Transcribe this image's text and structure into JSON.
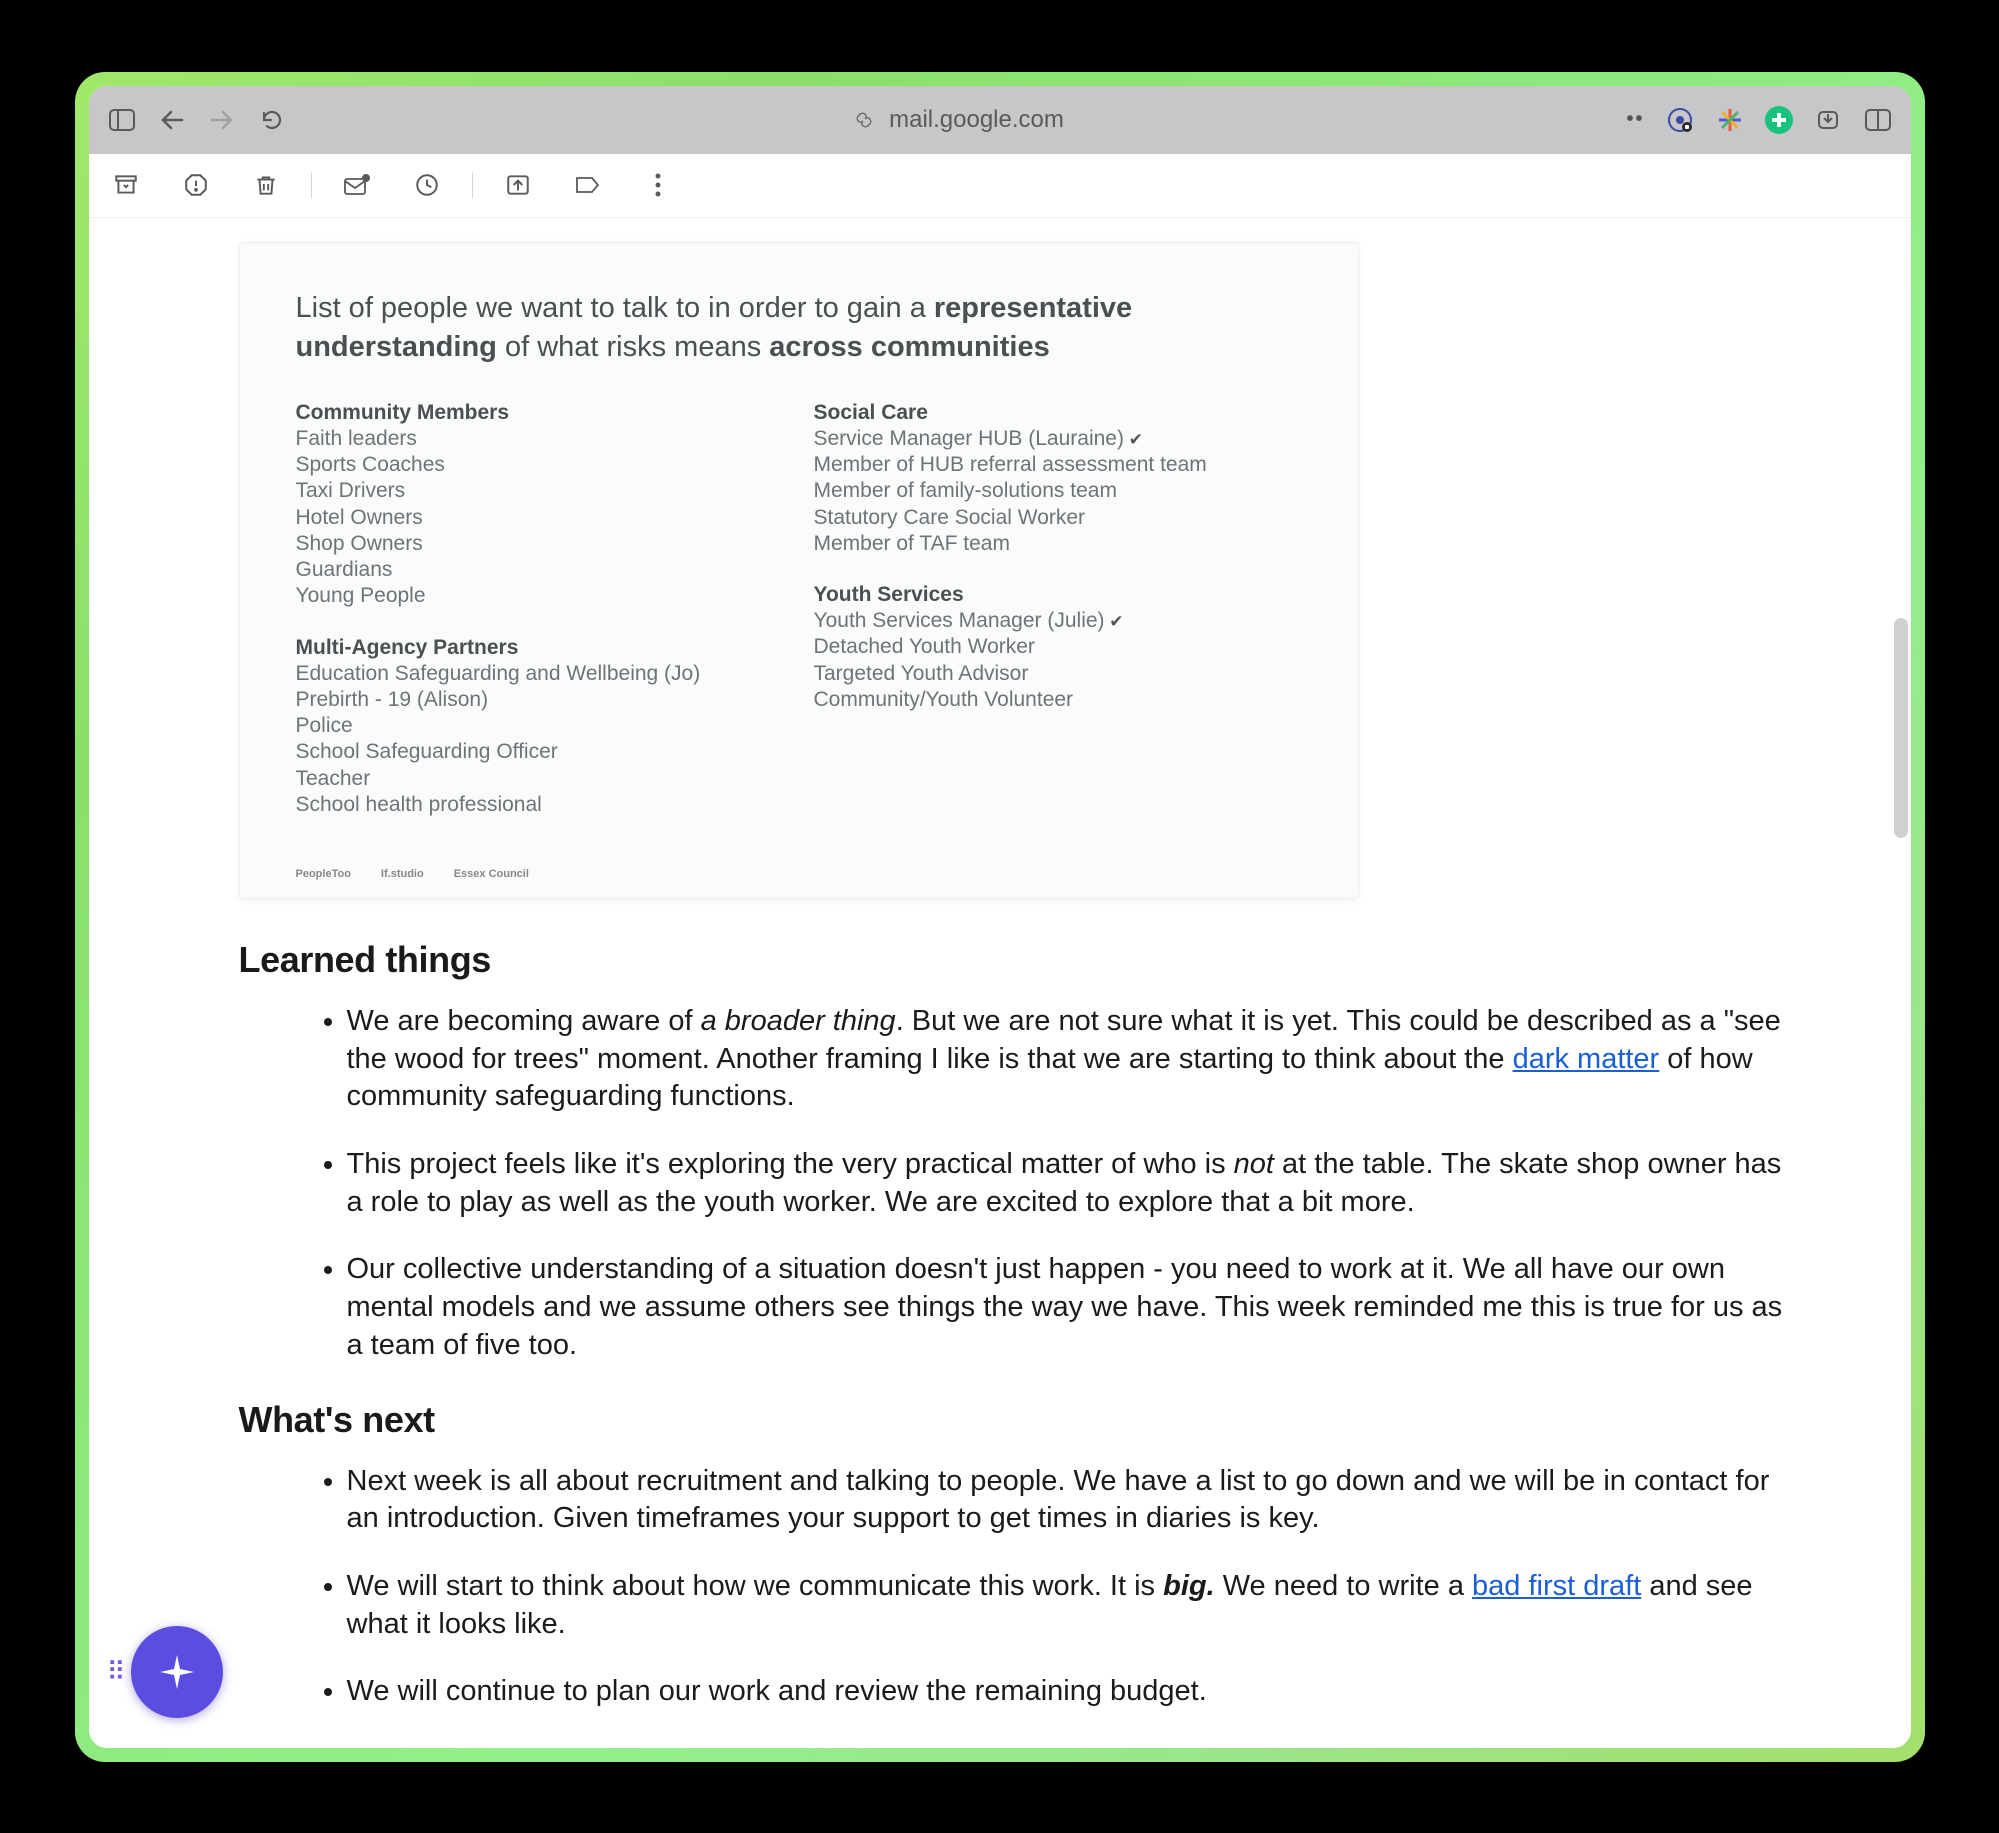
{
  "browser": {
    "url": "mail.google.com",
    "password_indicator": "••"
  },
  "card": {
    "title_pre": "List of people we want to talk to in order to gain a ",
    "title_bold1": "representative understanding",
    "title_mid": " of what risks means ",
    "title_bold2": "across communities",
    "groups_left": [
      {
        "heading": "Community Members",
        "items": [
          "Faith leaders",
          "Sports Coaches",
          "Taxi Drivers",
          "Hotel Owners",
          "Shop Owners",
          "Guardians",
          "Young People"
        ]
      },
      {
        "heading": "Multi-Agency Partners",
        "items": [
          "Education Safeguarding and Wellbeing (Jo)",
          "Prebirth - 19 (Alison)",
          "Police",
          "School Safeguarding Officer",
          "Teacher",
          "School health professional"
        ]
      }
    ],
    "groups_right": [
      {
        "heading": "Social Care",
        "items": [
          {
            "text": "Service Manager HUB (Lauraine)",
            "check": true
          },
          {
            "text": "Member of HUB referral assessment team"
          },
          {
            "text": "Member of family-solutions team"
          },
          {
            "text": "Statutory Care Social Worker"
          },
          {
            "text": "Member of TAF team"
          }
        ]
      },
      {
        "heading": "Youth Services",
        "items": [
          {
            "text": "Youth Services Manager (Julie)",
            "check": true
          },
          {
            "text": "Detached Youth Worker"
          },
          {
            "text": "Targeted Youth Advisor"
          },
          {
            "text": "Community/Youth Volunteer"
          }
        ]
      }
    ],
    "footer": [
      "PeopleToo",
      "If.studio",
      "Essex Council"
    ]
  },
  "doc": {
    "section1": "Learned things",
    "bullets1": [
      {
        "parts": [
          {
            "t": "We are becoming aware of "
          },
          {
            "t": "a broader thing",
            "em": true
          },
          {
            "t": ". But we are not sure what it is yet. This could be described as a \"see the wood for trees\" moment. Another framing I like is that we are starting to think about the "
          },
          {
            "t": "dark matter",
            "link": true
          },
          {
            "t": " of how community safeguarding functions."
          }
        ]
      },
      {
        "parts": [
          {
            "t": "This project feels like it's exploring the very practical matter of who is "
          },
          {
            "t": "not",
            "em": true
          },
          {
            "t": " at the table. The skate shop owner has a role to play as well as the youth worker. We are excited to explore that a bit more."
          }
        ]
      },
      {
        "parts": [
          {
            "t": "Our collective understanding of a situation doesn't just happen - you need to work at it. We all have our own mental models and we assume others see things the way we have. This week reminded me this is true for us as a team of five too."
          }
        ]
      }
    ],
    "section2": "What's next",
    "bullets2": [
      {
        "parts": [
          {
            "t": "Next week is all about recruitment and talking to people. We have a list to go down and we will be in contact for an introduction. Given timeframes your support to get times in diaries is key."
          }
        ]
      },
      {
        "parts": [
          {
            "t": "We will start to think about how we communicate this work. It is "
          },
          {
            "t": "big.",
            "b": true,
            "em": true
          },
          {
            "t": " We need to write a ",
            "em": false
          },
          {
            "t": "bad first draft",
            "link": true
          },
          {
            "t": " and see what it looks like."
          }
        ]
      },
      {
        "parts": [
          {
            "t": "We will continue to plan our work and review the remaining budget."
          }
        ]
      }
    ]
  }
}
